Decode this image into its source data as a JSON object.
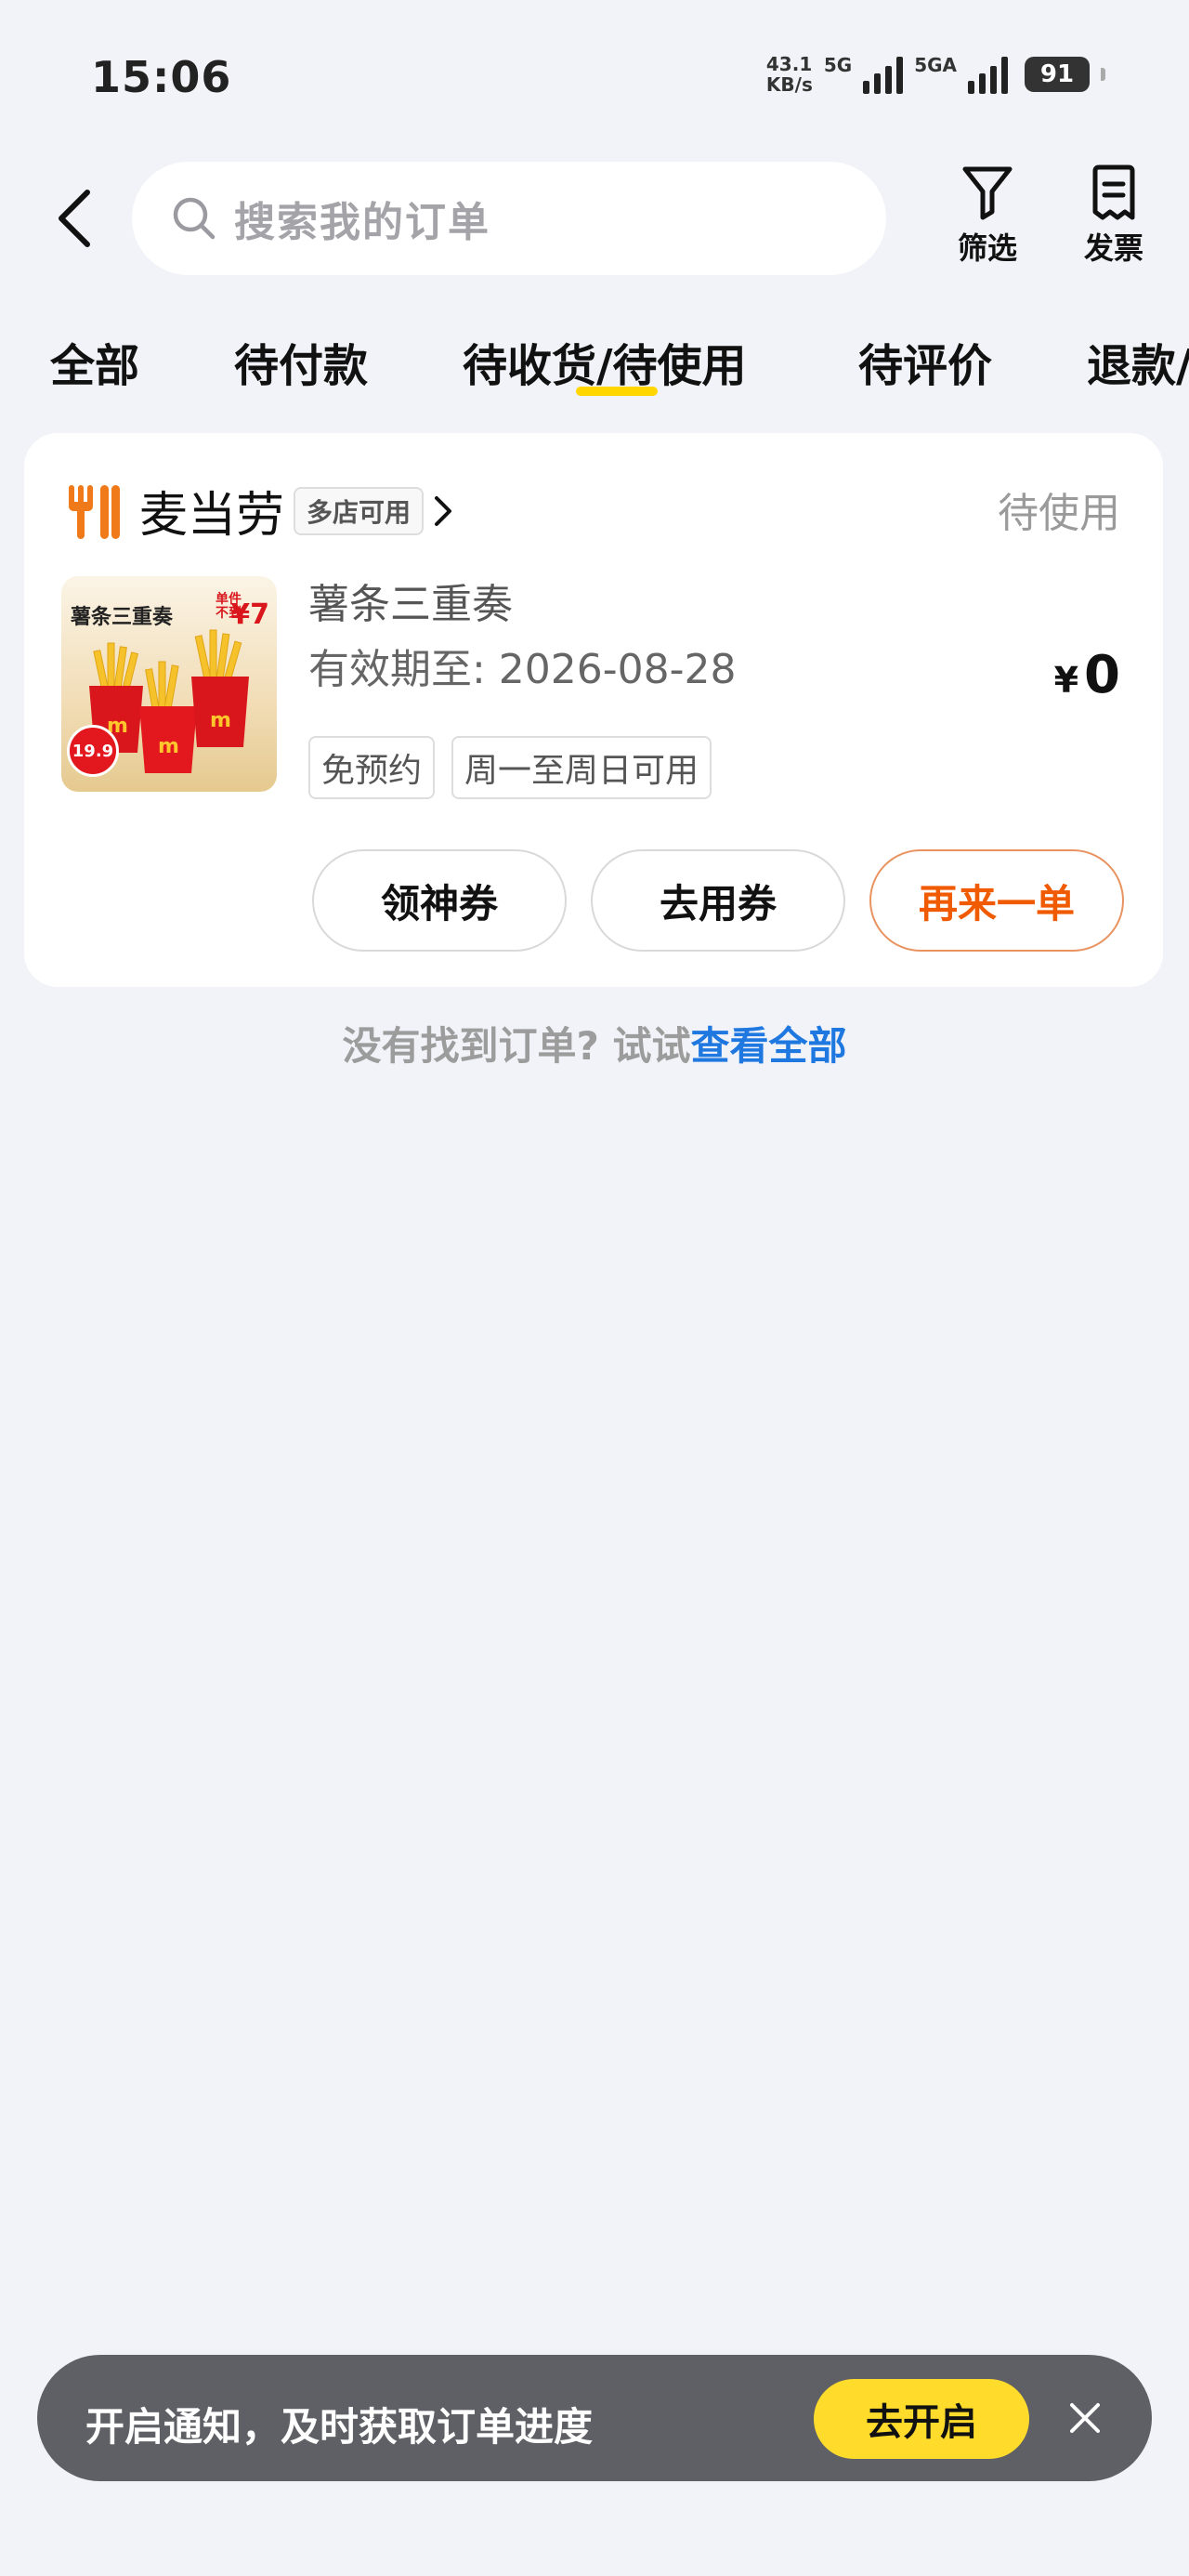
{
  "status_bar": {
    "time": "15:06",
    "net_speed_value": "43.1",
    "net_speed_unit": "KB/s",
    "sig1_label": "5G",
    "sig2_label": "5GA",
    "battery": "91"
  },
  "header": {
    "search_placeholder": "搜索我的订单",
    "filter_label": "筛选",
    "invoice_label": "发票"
  },
  "tabs": [
    {
      "label": "全部"
    },
    {
      "label": "待付款"
    },
    {
      "label": "待收货/待使用",
      "active": true
    },
    {
      "label": "待评价"
    },
    {
      "label": "退款/"
    }
  ],
  "order": {
    "store_name": "麦当劳",
    "multi_store_tag": "多店可用",
    "status": "待使用",
    "thumb_title": "薯条三重奏",
    "thumb_price_small": "单件\n不到",
    "thumb_price": "¥7",
    "thumb_badge": "19.9",
    "product_name": "薯条三重奏",
    "valid_until": "有效期至: 2026-08-28",
    "price_symbol": "¥",
    "price_value": "0",
    "tags": [
      "免预约",
      "周一至周日可用"
    ],
    "buttons": {
      "coupon": "领神券",
      "use": "去用券",
      "reorder": "再来一单"
    }
  },
  "empty_hint": {
    "text": "没有找到订单? 试试",
    "link": "查看全部"
  },
  "notify": {
    "text": "开启通知，及时获取订单进度",
    "button": "去开启"
  },
  "colors": {
    "accent_yellow": "#ffd600",
    "reorder_orange": "#f05a00",
    "link_blue": "#1f78e0"
  }
}
